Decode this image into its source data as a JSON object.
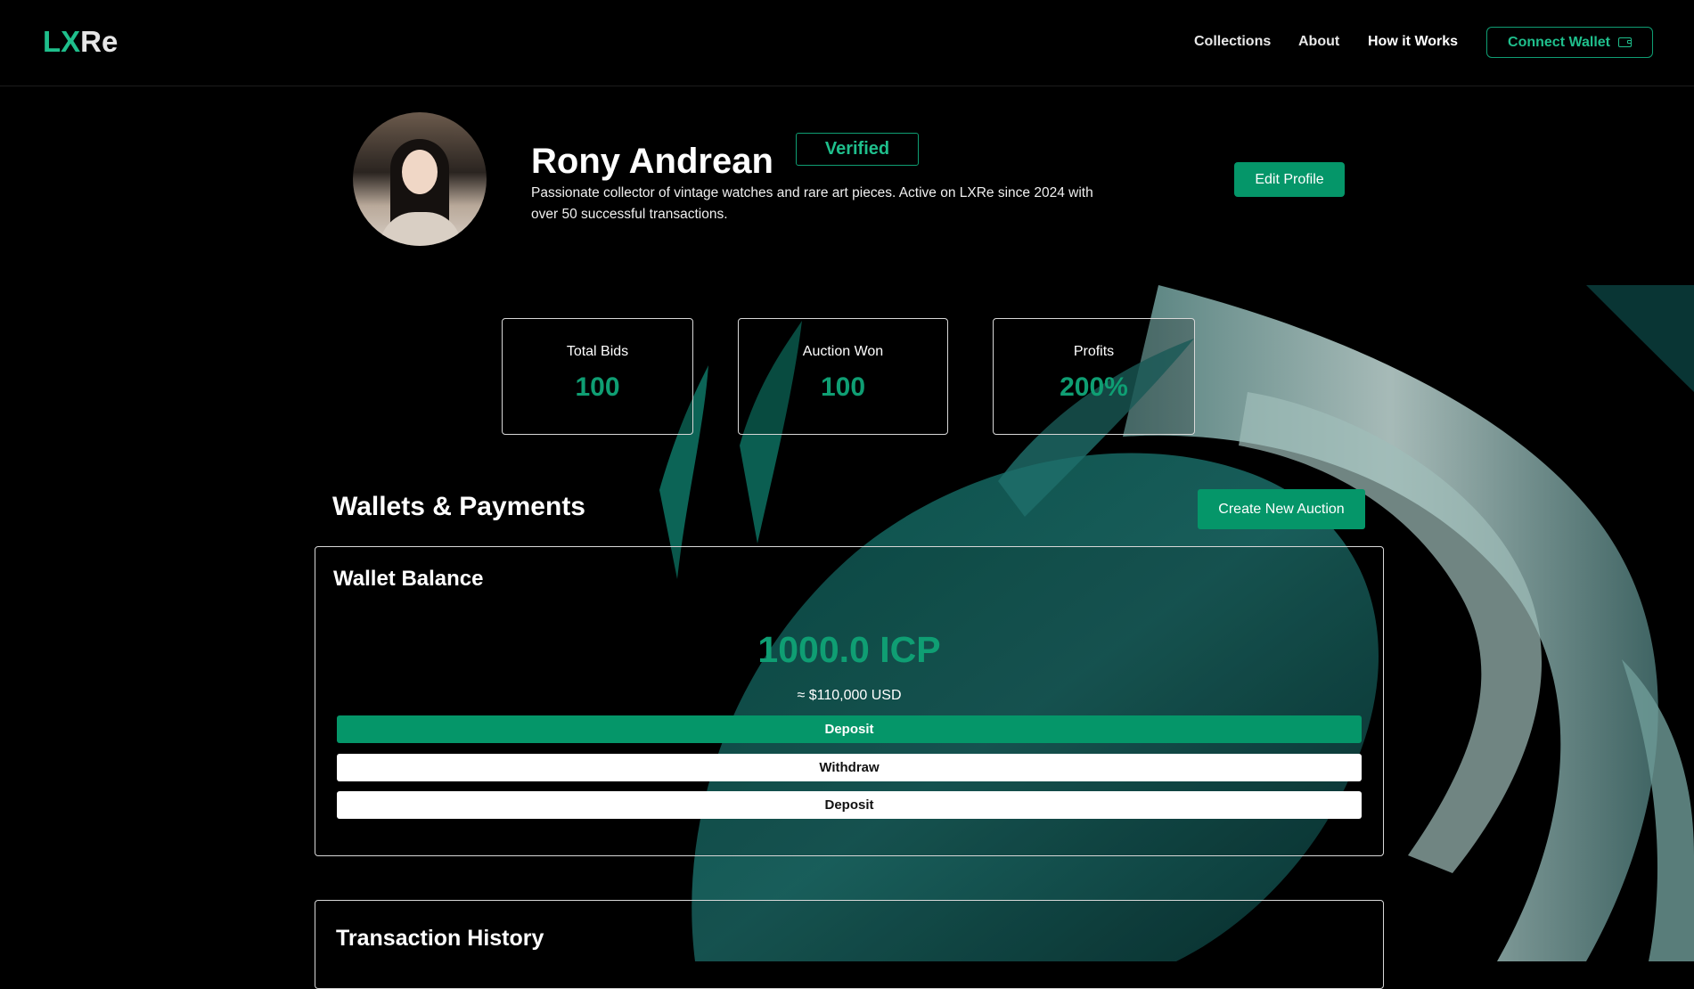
{
  "header": {
    "logo_lx": "LX",
    "logo_re": "Re",
    "nav": [
      "Collections",
      "About",
      "How it Works"
    ],
    "connect_wallet": "Connect Wallet"
  },
  "profile": {
    "name": "Rony Andrean",
    "verified_badge": "Verified",
    "bio": "Passionate collector of vintage watches and rare art pieces. Active on LXRe since 2024 with over 50 successful transactions.",
    "edit_button": "Edit Profile"
  },
  "stats": [
    {
      "label": "Total Bids",
      "value": "100"
    },
    {
      "label": "Auction Won",
      "value": "100"
    },
    {
      "label": "Profits",
      "value": "200%"
    }
  ],
  "wallets": {
    "section_title": "Wallets & Payments",
    "create_auction_button": "Create New Auction",
    "card_title": "Wallet Balance",
    "balance": "1000.0 ICP",
    "usd_equivalent": "≈ $110,000 USD",
    "buttons": [
      "Deposit",
      "Withdraw",
      "Deposit"
    ]
  },
  "transactions": {
    "title": "Transaction History"
  },
  "colors": {
    "accent": "#059669",
    "accent_text": "#0f9e73",
    "background": "#000000"
  }
}
